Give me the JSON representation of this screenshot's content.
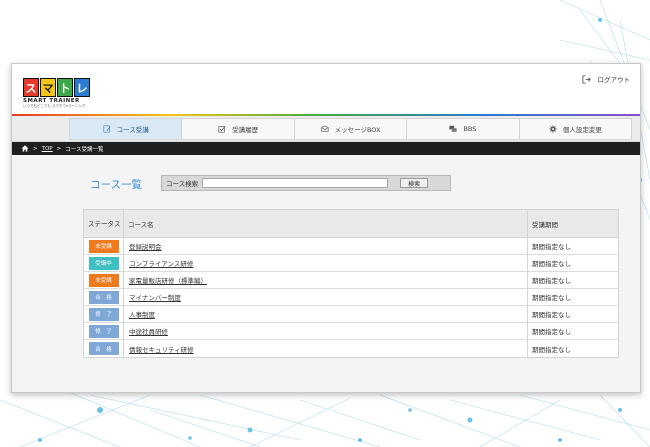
{
  "logo": {
    "blocks": [
      "ス",
      "マ",
      "ト",
      "レ"
    ],
    "text": "SMART TRAINER",
    "sub": "いつでもどこでも スマホでeラーニング"
  },
  "header": {
    "logout_label": "ログアウト"
  },
  "nav": {
    "tabs": [
      {
        "label": "コース受講",
        "icon": "edit-icon",
        "active": true
      },
      {
        "label": "受講履歴",
        "icon": "checkbox-icon",
        "active": false
      },
      {
        "label": "メッセージBOX",
        "icon": "message-icon",
        "active": false
      },
      {
        "label": "BBS",
        "icon": "chat-icon",
        "active": false
      },
      {
        "label": "個人設定変更",
        "icon": "gear-icon",
        "active": false
      }
    ]
  },
  "breadcrumb": {
    "top": "TOP",
    "sep": ">",
    "current": "コース受講一覧"
  },
  "page": {
    "title": "コース一覧"
  },
  "search": {
    "label": "コース検索",
    "value": "",
    "button": "検索"
  },
  "table": {
    "headers": {
      "status": "ステータス",
      "name": "コース名",
      "period": "受講期間"
    },
    "rows": [
      {
        "status": "未受講",
        "color": "#f07a1e",
        "name": "登録説明会",
        "period": "期間指定なし"
      },
      {
        "status": "受講中",
        "color": "#3fbfc4",
        "name": "コンプライアンス研修",
        "period": "期間指定なし"
      },
      {
        "status": "未受講",
        "color": "#f07a1e",
        "name": "家電量販店研修（標準編）",
        "period": "期間指定なし"
      },
      {
        "status": "合　格",
        "color": "#7fa8d6",
        "name": "マイナンバー制度",
        "period": "期間指定なし"
      },
      {
        "status": "修　了",
        "color": "#7fa8d6",
        "name": "人事制度",
        "period": "期間指定なし"
      },
      {
        "status": "修　了",
        "color": "#7fa8d6",
        "name": "中途社員研修",
        "period": "期間指定なし"
      },
      {
        "status": "合　格",
        "color": "#7fa8d6",
        "name": "情報セキュリティ研修",
        "period": "期間指定なし"
      }
    ]
  }
}
